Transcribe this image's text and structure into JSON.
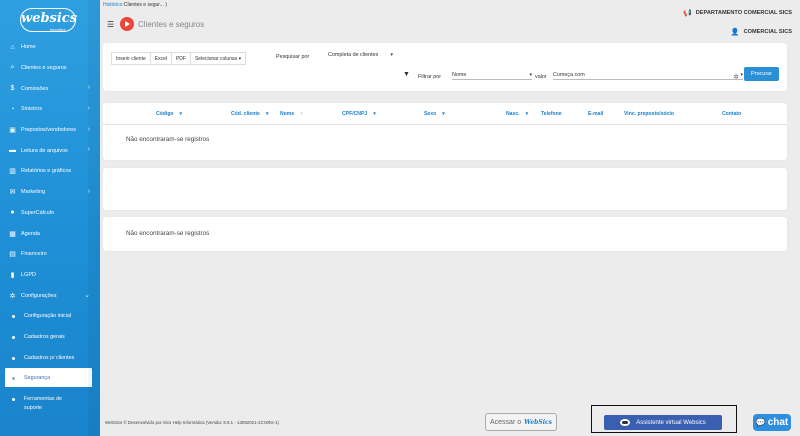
{
  "sidebar": {
    "logo": "websics",
    "logo_sub": "master",
    "items": [
      {
        "label": "Home",
        "icon": "home-icon",
        "glyph": "⌂",
        "chevron": false
      },
      {
        "label": "Clientes e seguros",
        "icon": "search-icon",
        "glyph": "⌕",
        "chevron": false
      },
      {
        "label": "Comissões",
        "icon": "dollar-icon",
        "glyph": "$",
        "chevron": true
      },
      {
        "label": "Sinistros",
        "icon": "bell-icon",
        "glyph": "◔",
        "chevron": true
      },
      {
        "label": "Prepostos/vendedores",
        "icon": "briefcase-icon",
        "glyph": "▣",
        "chevron": true
      },
      {
        "label": "Leitura de arquivos",
        "icon": "folder-icon",
        "glyph": "▬",
        "chevron": true
      },
      {
        "label": "Relatórios e gráficos",
        "icon": "chart-icon",
        "glyph": "▥",
        "chevron": false
      },
      {
        "label": "Marketing",
        "icon": "mail-icon",
        "glyph": "✉",
        "chevron": true
      },
      {
        "label": "SuperCálculo",
        "icon": "calculator-icon",
        "glyph": "●",
        "chevron": false
      },
      {
        "label": "Agenda",
        "icon": "calendar-icon",
        "glyph": "▦",
        "chevron": false
      },
      {
        "label": "Financeiro",
        "icon": "bank-icon",
        "glyph": "▤",
        "chevron": false
      },
      {
        "label": "LGPD",
        "icon": "lock-icon",
        "glyph": "▮",
        "chevron": false
      },
      {
        "label": "Configurações",
        "icon": "gear-icon",
        "glyph": "✲",
        "chevron": "down"
      }
    ],
    "subitems": [
      {
        "label": "Configuração inicial",
        "active": false
      },
      {
        "label": "Cadastros gerais",
        "active": false
      },
      {
        "label": "Cadastros p/ clientes",
        "active": false
      },
      {
        "label": "Segurança",
        "active": true
      },
      {
        "label_line1": "Ferramentas de",
        "label_line2": "suporte",
        "active": false
      }
    ]
  },
  "header": {
    "breadcrumb_link": "Histórico:",
    "breadcrumb_text": "Clientes e segur... )",
    "title": "Clientes e seguros",
    "department": "DEPARTAMENTO COMERCIAL SICS",
    "user": "COMERCIAL SICS"
  },
  "toolbar": {
    "buttons": [
      "Inserir cliente",
      "Excel",
      "PDF",
      "Selecionar colunas"
    ],
    "pesquisar_por_label": "Pesquisar por",
    "pesquisar_por_value": "Completa de clientes",
    "filtrar_por_label": "Filtrar por",
    "filtrar_por_value": "Nome",
    "valor_label": "valor",
    "valor_value": "Começa com",
    "search_button": "Procurar"
  },
  "table": {
    "columns": [
      "Código",
      "Cód. cliente",
      "Nome",
      "CPF/CNPJ",
      "Sexo",
      "Nasc.",
      "Telefone",
      "E-mail",
      "Vinc. preposto/sócio",
      "Contato"
    ],
    "empty_message": "Não encontraram-se registros"
  },
  "second_table": {
    "empty_message": "Não encontraram-se registros"
  },
  "footer": {
    "text": "WebSics © Desenvolvido por Sics Help Informática (Versão: 8.9.1 - 13092021-22:00hs-1)",
    "acessar_label": "Acessar o",
    "acessar_brand": "WebSics",
    "assistant_label": "Assistente virtual Websics",
    "chat_label": "chat"
  }
}
